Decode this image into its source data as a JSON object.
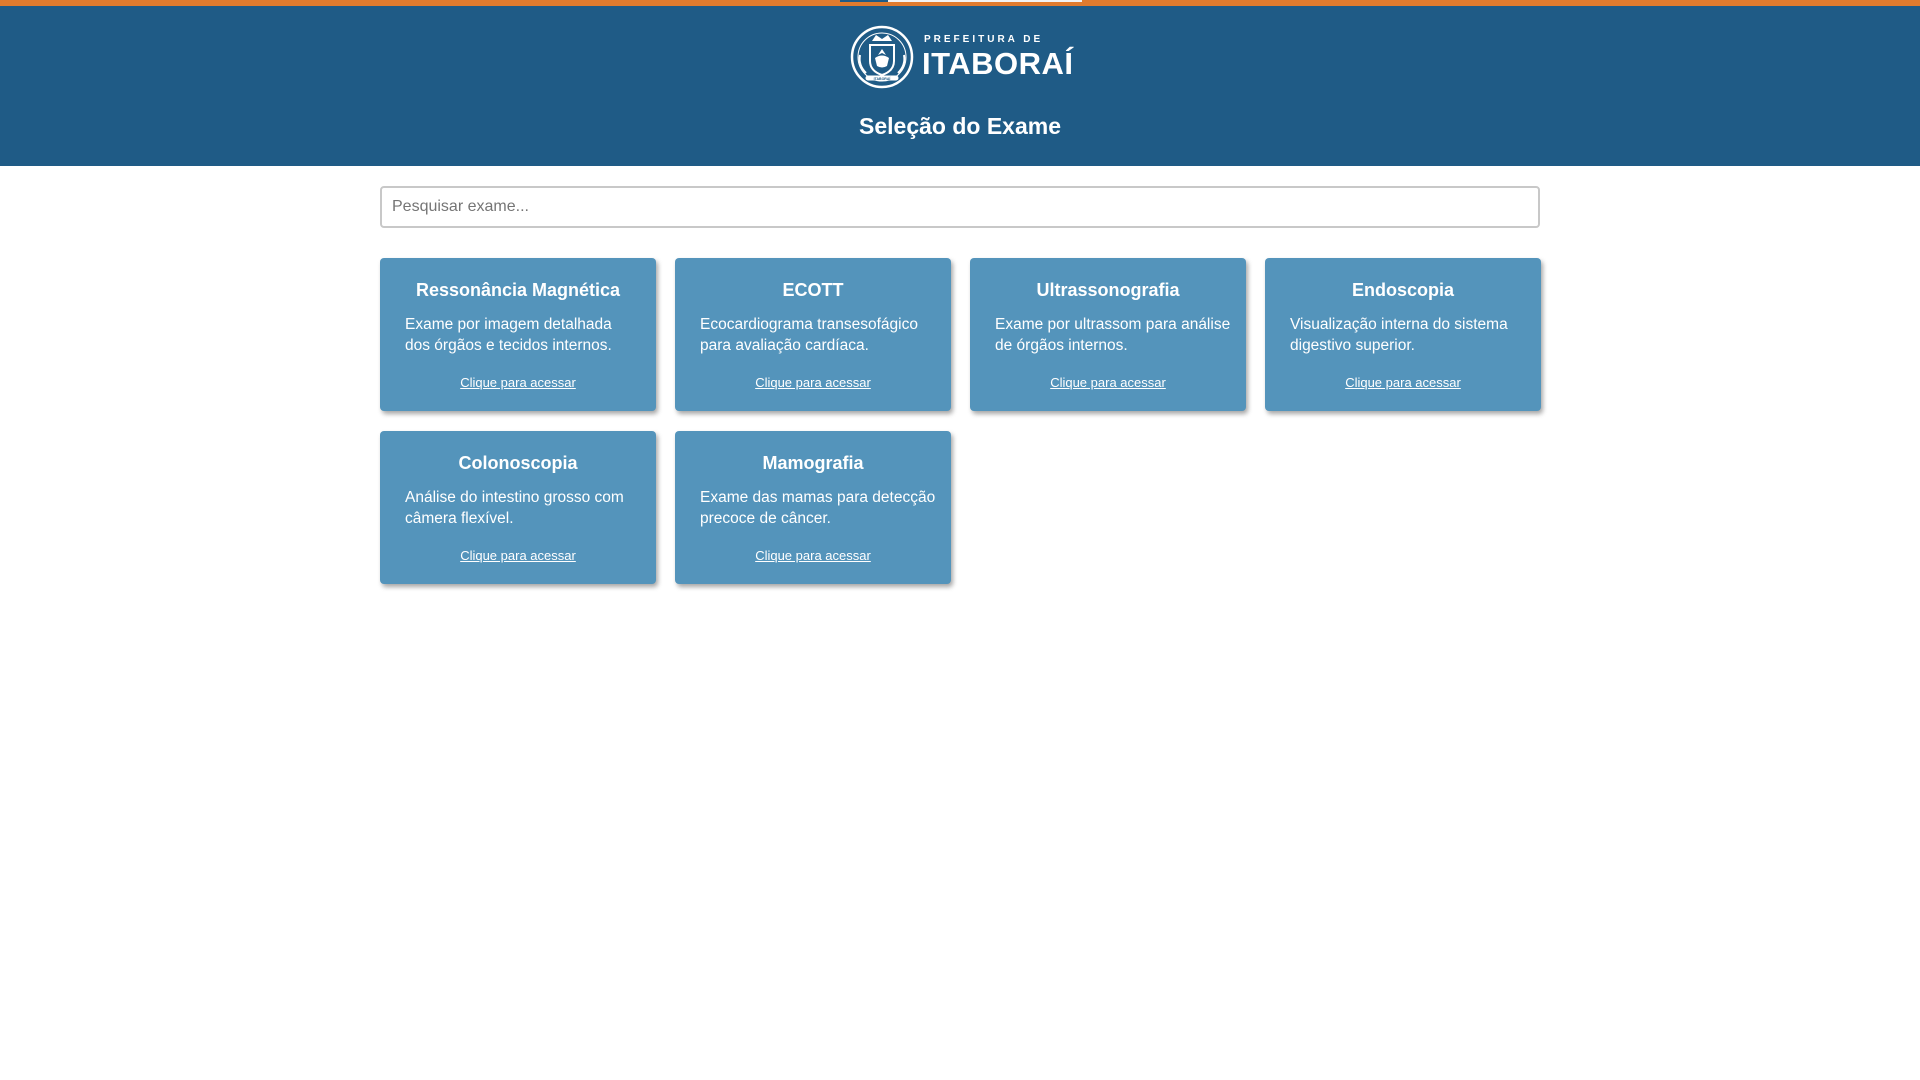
{
  "header": {
    "logo_small": "PREFEITURA DE",
    "logo_big": "ITABORAÍ",
    "crest_text": "ITABORAÍ",
    "title": "Seleção do Exame"
  },
  "search": {
    "placeholder": "Pesquisar exame...",
    "value": ""
  },
  "colors": {
    "accent": "#e07b2e",
    "header": "#1f5b86",
    "card": "#5494bb"
  },
  "icons": {
    "logo": "crest-icon"
  },
  "exams": [
    {
      "title": "Ressonância Magnética",
      "desc": "Exame por imagem detalhada dos órgãos e tecidos internos.",
      "link": "Clique para acessar"
    },
    {
      "title": "ECOTT",
      "desc": "Ecocardiograma transesofágico para avaliação cardíaca.",
      "link": "Clique para acessar"
    },
    {
      "title": "Ultrassonografia",
      "desc": "Exame por ultrassom para análise de órgãos internos.",
      "link": "Clique para acessar"
    },
    {
      "title": "Endoscopia",
      "desc": "Visualização interna do sistema digestivo superior.",
      "link": "Clique para acessar"
    },
    {
      "title": "Colonoscopia",
      "desc": "Análise do intestino grosso com câmera flexível.",
      "link": "Clique para acessar"
    },
    {
      "title": "Mamografia",
      "desc": "Exame das mamas para detecção precoce de câncer.",
      "link": "Clique para acessar"
    }
  ]
}
